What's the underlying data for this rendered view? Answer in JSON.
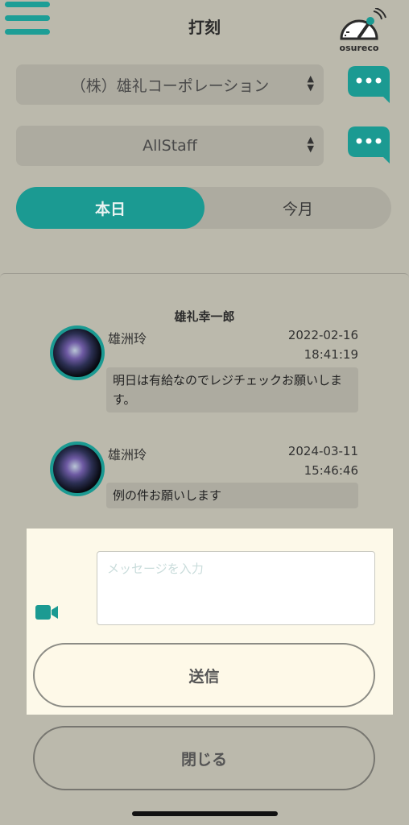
{
  "header": {
    "title": "打刻",
    "logo_text": "osureco",
    "menu_icon": "hamburger-icon"
  },
  "selectors": {
    "company": "（株）雄礼コーポレーション",
    "group": "AllStaff"
  },
  "tabs": {
    "today": "本日",
    "month": "今月"
  },
  "sheet": {
    "title": "雄礼幸一郎",
    "messages": [
      {
        "sender": "雄洲玲",
        "date": "2022-02-16",
        "time": "18:41:19",
        "text": "明日は有給なのでレジチェックお願いします。"
      },
      {
        "sender": "雄洲玲",
        "date": "2024-03-11",
        "time": "15:46:46",
        "text": "例の件お願いします"
      }
    ],
    "input_placeholder": "メッセージを入力",
    "send_label": "送信",
    "close_label": "閉じる"
  },
  "colors": {
    "accent": "#1b9a92",
    "background": "#bbb9ac",
    "compose_background": "#fdf9e9"
  }
}
